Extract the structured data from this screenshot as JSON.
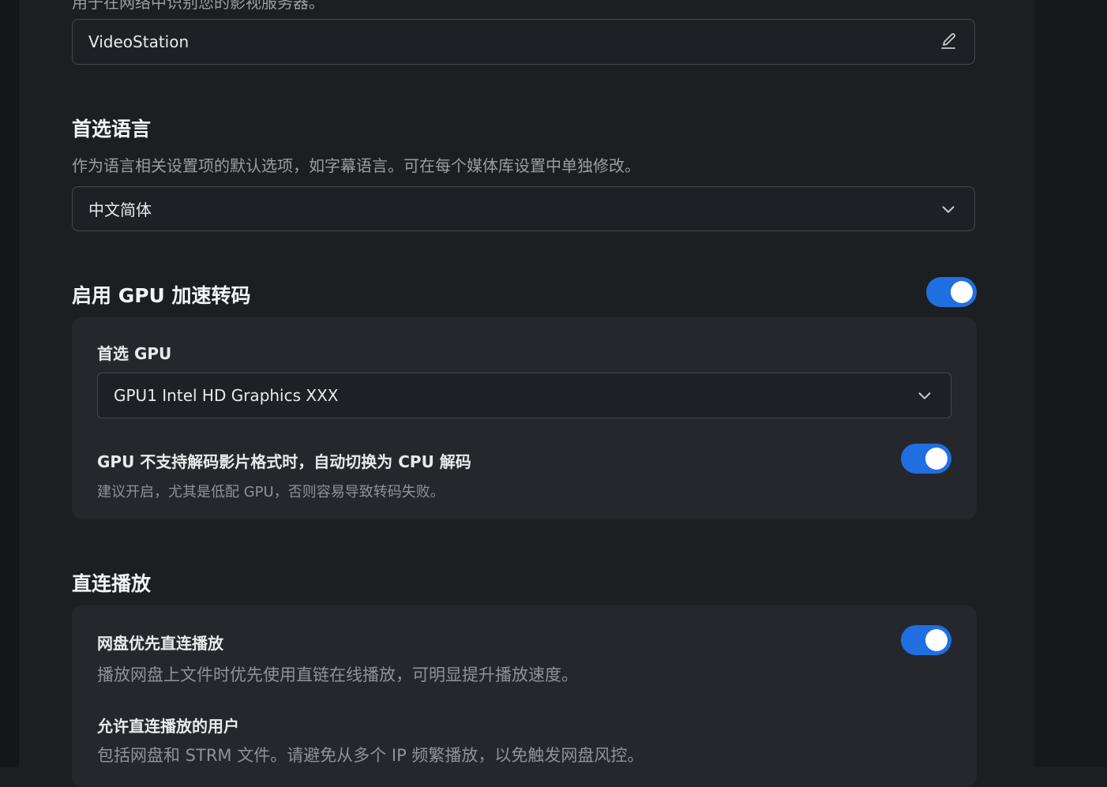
{
  "server_name": {
    "description": "用于在网络中识别您的影视服务器。",
    "value": "VideoStation",
    "icon": "edit-icon"
  },
  "preferred_language": {
    "title": "首选语言",
    "description": "作为语言相关设置项的默认选项，如字幕语言。可在每个媒体库设置中单独修改。",
    "selected": "中文简体",
    "icon": "chevron-down-icon"
  },
  "gpu_transcoding": {
    "title": "启用 GPU 加速转码",
    "enabled": true,
    "preferred_gpu_label": "首选 GPU",
    "preferred_gpu_selected": "GPU1 Intel HD Graphics XXX",
    "fallback_label": "GPU 不支持解码影片格式时，自动切换为 CPU 解码",
    "fallback_description": "建议开启，尤其是低配 GPU，否则容易导致转码失败。",
    "fallback_enabled": true
  },
  "direct_play": {
    "title": "直连播放",
    "cloud_priority_label": "网盘优先直连播放",
    "cloud_priority_description": "播放网盘上文件时优先使用直链在线播放，可明显提升播放速度。",
    "cloud_priority_enabled": true,
    "allowed_users_label": "允许直连播放的用户",
    "allowed_users_description": "包括网盘和 STRM 文件。请避免从多个 IP 频繁播放，以免触发网盘风控。"
  },
  "colors": {
    "accent": "#1f6fe0",
    "background": "#1d1e22",
    "card": "#25272c"
  }
}
